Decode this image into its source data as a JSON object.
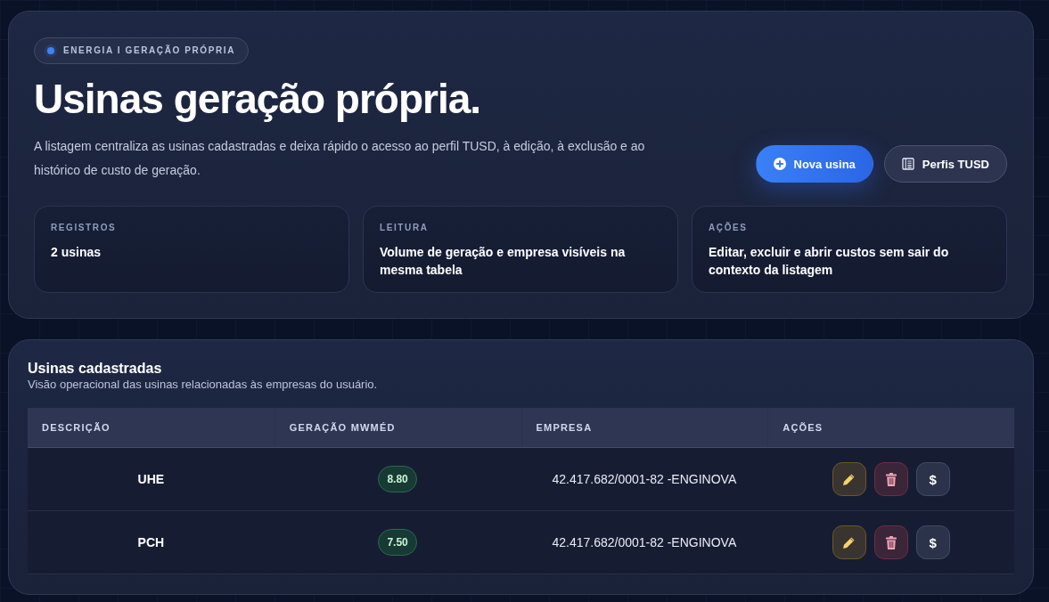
{
  "header": {
    "badge": "ENERGIA I GERAÇÃO PRÓPRIA",
    "title": "Usinas geração própria.",
    "description": "A listagem centraliza as usinas cadastradas e deixa rápido o acesso ao perfil TUSD, à edição, à exclusão e ao histórico de custo de geração.",
    "actions": [
      {
        "kind": "add",
        "label": "Nova usina"
      },
      {
        "kind": "profiles",
        "label": "Perfis TUSD"
      }
    ],
    "stats": [
      {
        "label": "REGISTROS",
        "value": "2 usinas"
      },
      {
        "label": "LEITURA",
        "value": "Volume de geração e empresa visíveis na mesma tabela"
      },
      {
        "label": "AÇÕES",
        "value": "Editar, excluir e abrir custos sem sair do contexto da listagem"
      }
    ]
  },
  "list": {
    "title": "Usinas cadastradas",
    "subtitle": "Visão operacional das usinas relacionadas às empresas do usuário.",
    "table": {
      "columns": [
        "DESCRIÇÃO",
        "GERAÇÃO MWMÉD",
        "EMPRESA",
        "AÇÕES"
      ],
      "rows": [
        {
          "description": "UHE",
          "generation": "8.80",
          "company": "42.417.682/0001-82 -ENGINOVA",
          "actions": [
            {
              "kind": "edit"
            },
            {
              "kind": "delete"
            },
            {
              "kind": "cost",
              "label": "$"
            }
          ]
        },
        {
          "description": "PCH",
          "generation": "7.50",
          "company": "42.417.682/0001-82 -ENGINOVA",
          "actions": [
            {
              "kind": "edit"
            },
            {
              "kind": "delete"
            },
            {
              "kind": "cost",
              "label": "$"
            }
          ]
        }
      ]
    }
  }
}
